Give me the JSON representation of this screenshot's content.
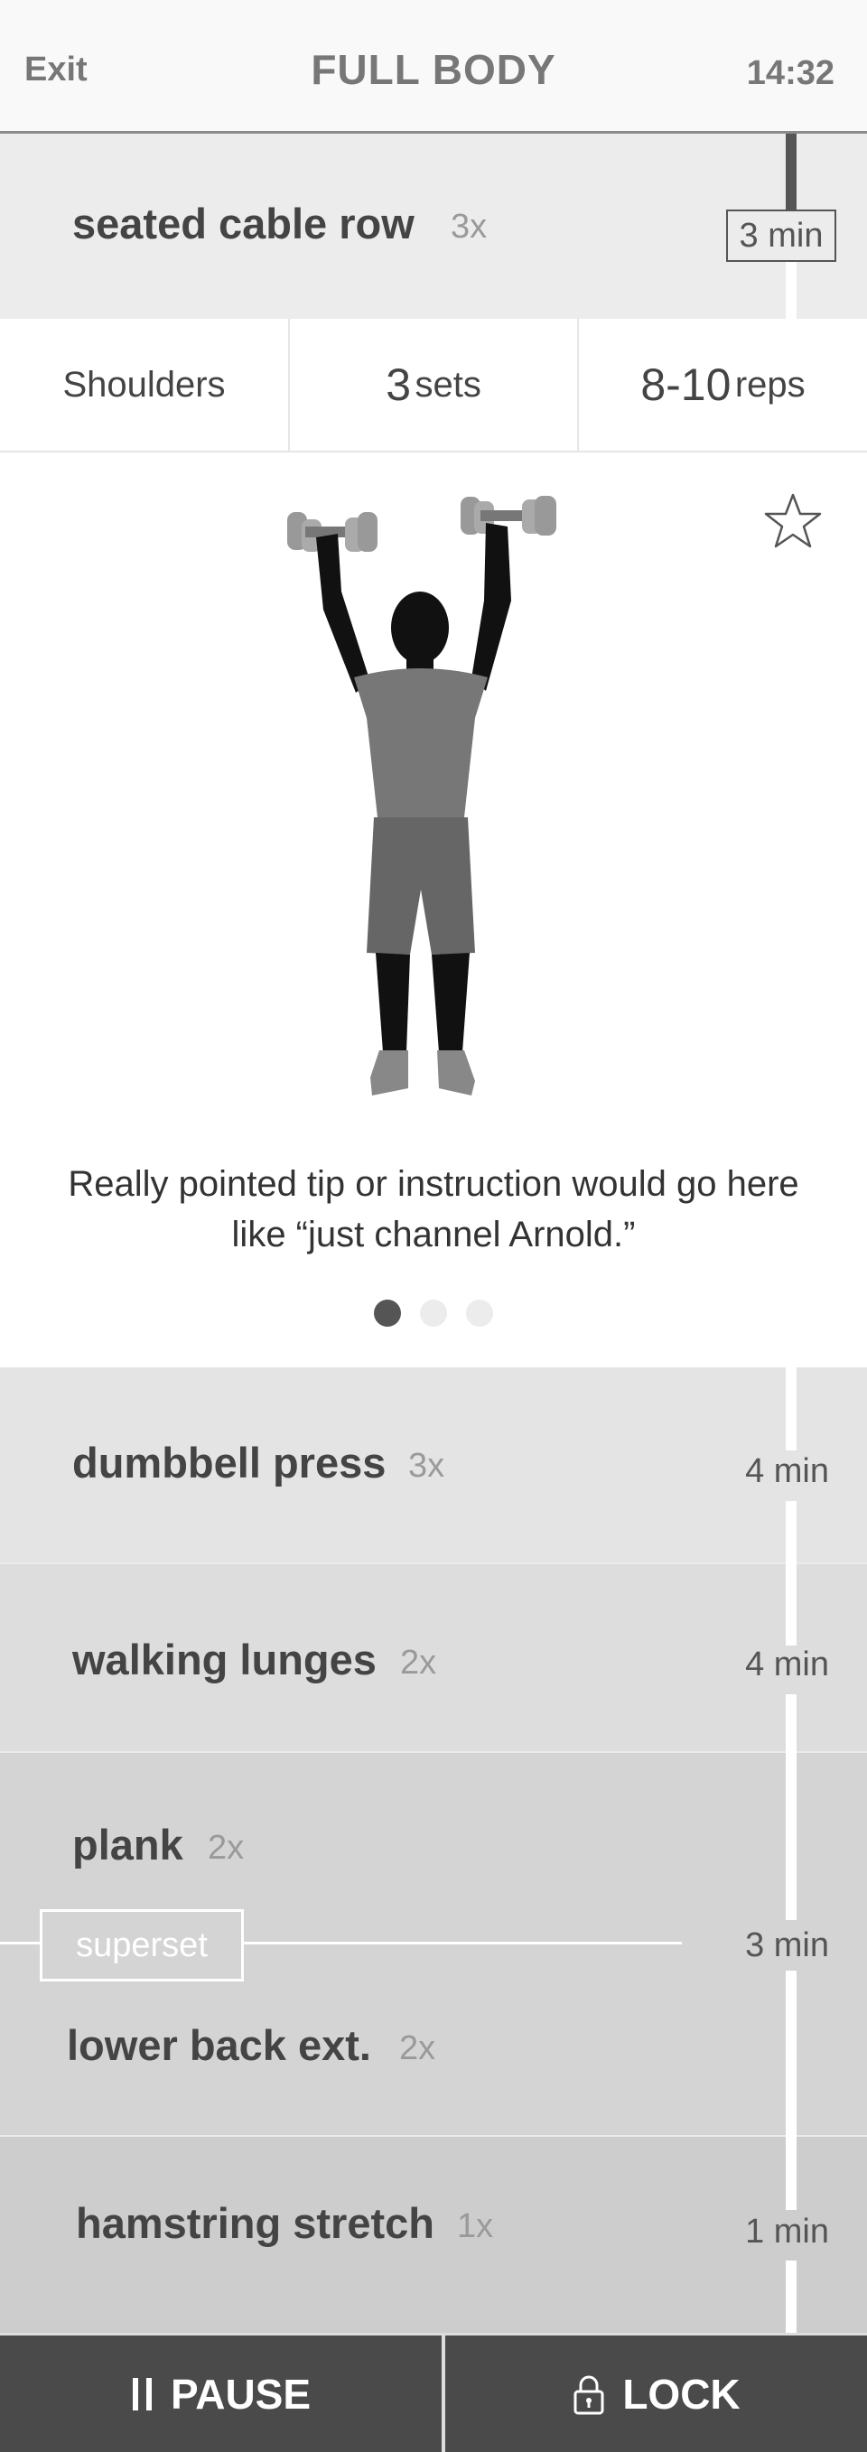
{
  "header": {
    "exit_label": "Exit",
    "title": "FULL BODY",
    "time": "14:32"
  },
  "current_exercise": {
    "name": "seated cable row",
    "count": "3x",
    "duration": "3 min"
  },
  "stats": {
    "muscle": "Shoulders",
    "sets_value": "3",
    "sets_unit": "sets",
    "reps_value": "8-10",
    "reps_unit": "reps"
  },
  "detail": {
    "tip": "Really pointed tip or instruction would go here like “just channel Arnold.”",
    "pager": {
      "total": 3,
      "active": 1
    },
    "favorite_icon": "star-outline-icon",
    "figure_icon": "person-overhead-dumbbell-press-silhouette"
  },
  "upcoming": [
    {
      "name": "dumbbell press",
      "count": "3x",
      "duration": "4 min"
    },
    {
      "name": "walking lunges",
      "count": "2x",
      "duration": "4 min"
    },
    {
      "name": "plank",
      "count": "2x",
      "superset_label": "superset",
      "duration": "3 min",
      "paired_name": "lower back ext.",
      "paired_count": "2x"
    },
    {
      "name": "hamstring stretch",
      "count": "1x",
      "duration": "1 min"
    }
  ],
  "footer": {
    "pause_label": "PAUSE",
    "pause_icon": "pause-icon",
    "lock_label": "LOCK",
    "lock_icon": "lock-icon"
  },
  "colors": {
    "progress": "#555555",
    "footer": "#4a4a4a",
    "row_bg_1": "#e4e4e4",
    "row_bg_2": "#dddddd",
    "row_bg_3": "#d4d4d4",
    "row_bg_4": "#cdcdcd"
  }
}
